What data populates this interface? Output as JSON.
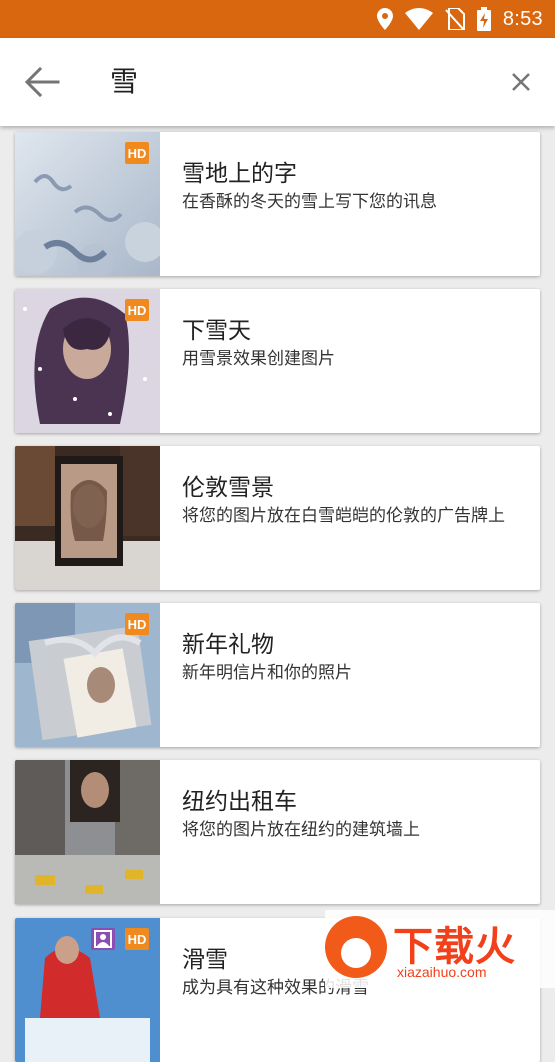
{
  "status_bar": {
    "time": "8:53"
  },
  "search": {
    "query": "雪"
  },
  "results": [
    {
      "title": "雪地上的字",
      "subtitle": "在香酥的冬天的雪上写下您的讯息",
      "hd": "HD"
    },
    {
      "title": "下雪天",
      "subtitle": "用雪景效果创建图片",
      "hd": "HD"
    },
    {
      "title": "伦敦雪景",
      "subtitle": "将您的图片放在白雪皑皑的伦敦的广告牌上",
      "hd": ""
    },
    {
      "title": "新年礼物",
      "subtitle": "新年明信片和你的照片",
      "hd": "HD"
    },
    {
      "title": "纽约出租车",
      "subtitle": "将您的图片放在纽约的建筑墙上",
      "hd": ""
    },
    {
      "title": "滑雪",
      "subtitle": "成为具有这种效果的滑雪",
      "hd": "HD"
    }
  ],
  "watermark": {
    "brand": "下载火",
    "url": "xiazaihuo.com"
  },
  "colors": {
    "status_bar": "#d9670f",
    "hd_badge": "#f08a1e",
    "alt_badge": "#8b4fb3"
  }
}
